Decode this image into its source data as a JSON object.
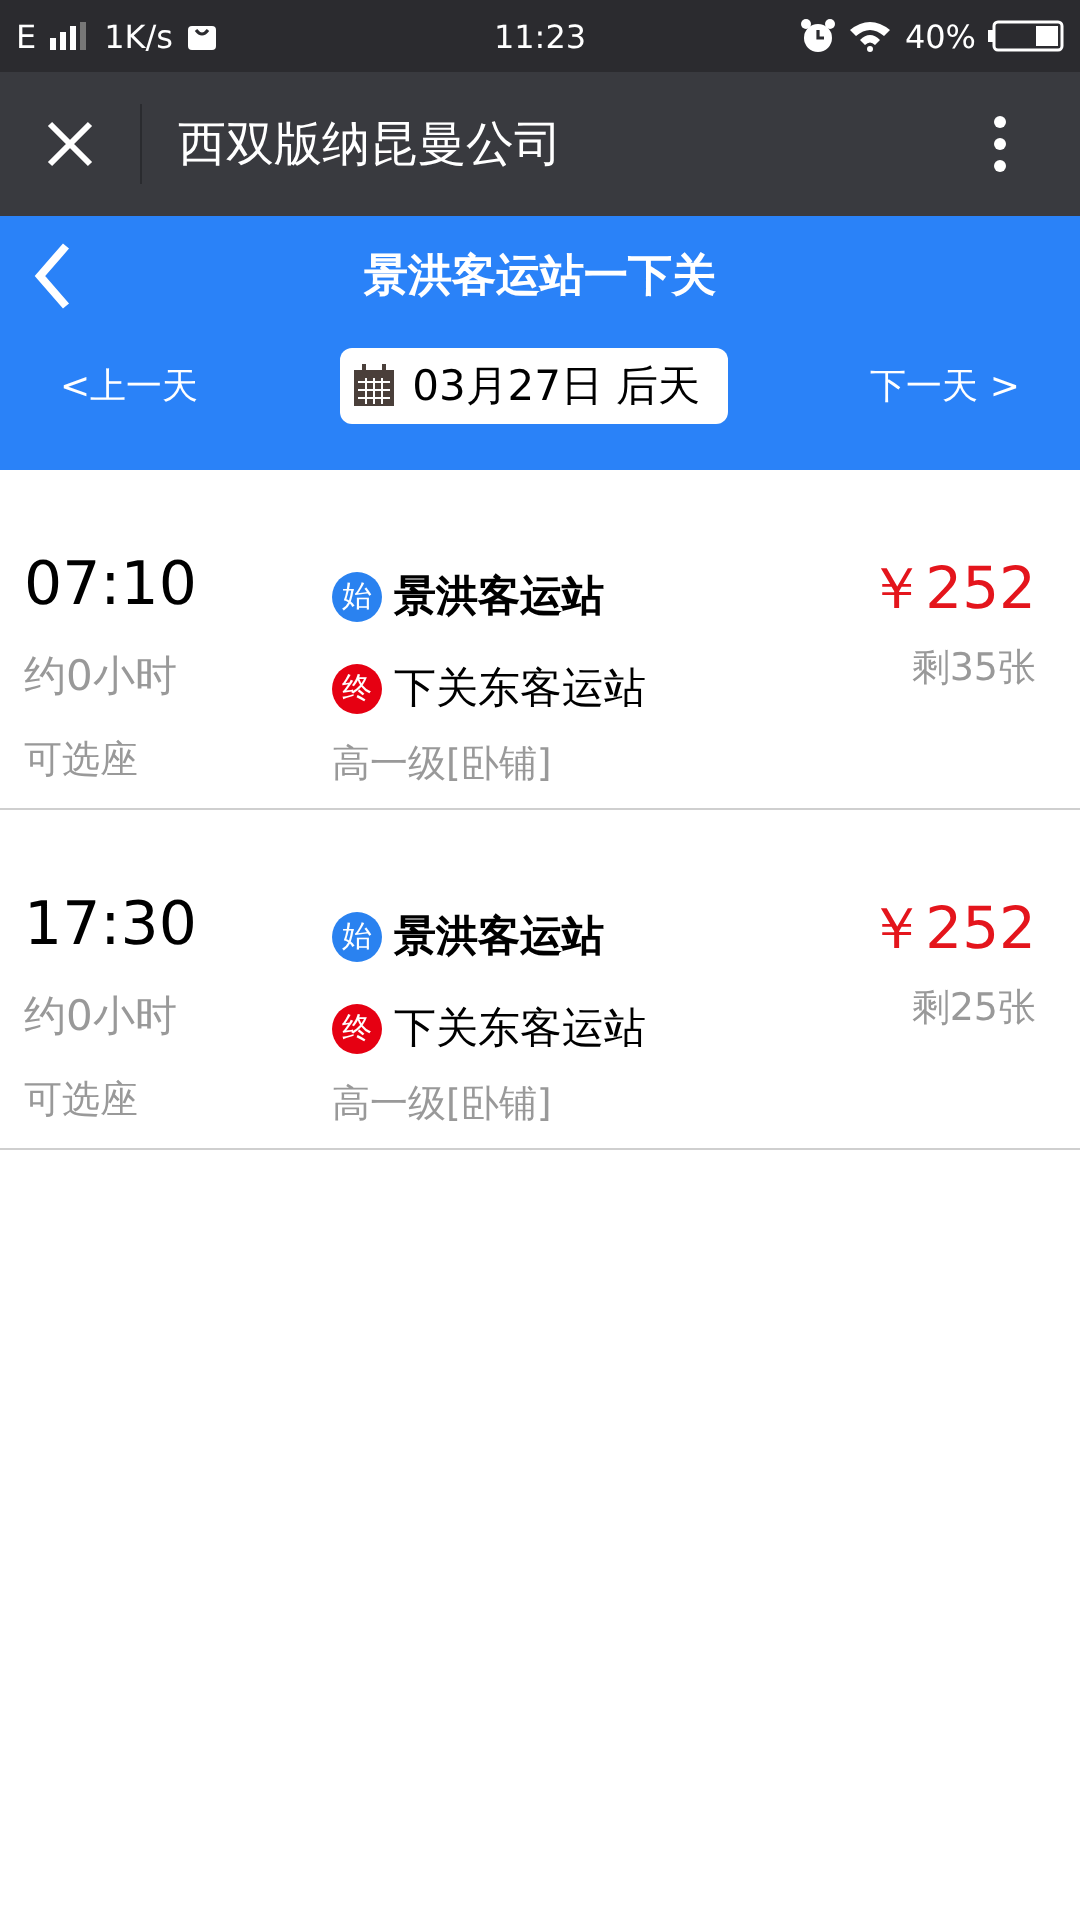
{
  "status_bar": {
    "network": "E",
    "speed": "1K/s",
    "time": "11:23",
    "battery": "40%"
  },
  "nav": {
    "title": "西双版纳昆曼公司"
  },
  "header": {
    "title": "景洪客运站一下关",
    "prev": "<上一天",
    "date": "03月27日 后天",
    "next": "下一天 >"
  },
  "trips": [
    {
      "time": "07:10",
      "duration": "约0小时",
      "seat": "可选座",
      "stops": [
        {
          "kind": "origin",
          "badge": "始",
          "name": "景洪客运站",
          "color": "#2a82f0"
        },
        {
          "kind": "destination",
          "badge": "终",
          "name": "下关东客运站",
          "color": "#e60012"
        }
      ],
      "grade": "高一级[卧铺]",
      "price": "￥252",
      "remaining": "剩35张"
    },
    {
      "time": "17:30",
      "duration": "约0小时",
      "seat": "可选座",
      "stops": [
        {
          "kind": "origin",
          "badge": "始",
          "name": "景洪客运站",
          "color": "#2a82f0"
        },
        {
          "kind": "destination",
          "badge": "终",
          "name": "下关东客运站",
          "color": "#e60012"
        }
      ],
      "grade": "高一级[卧铺]",
      "price": "￥252",
      "remaining": "剩25张"
    }
  ]
}
